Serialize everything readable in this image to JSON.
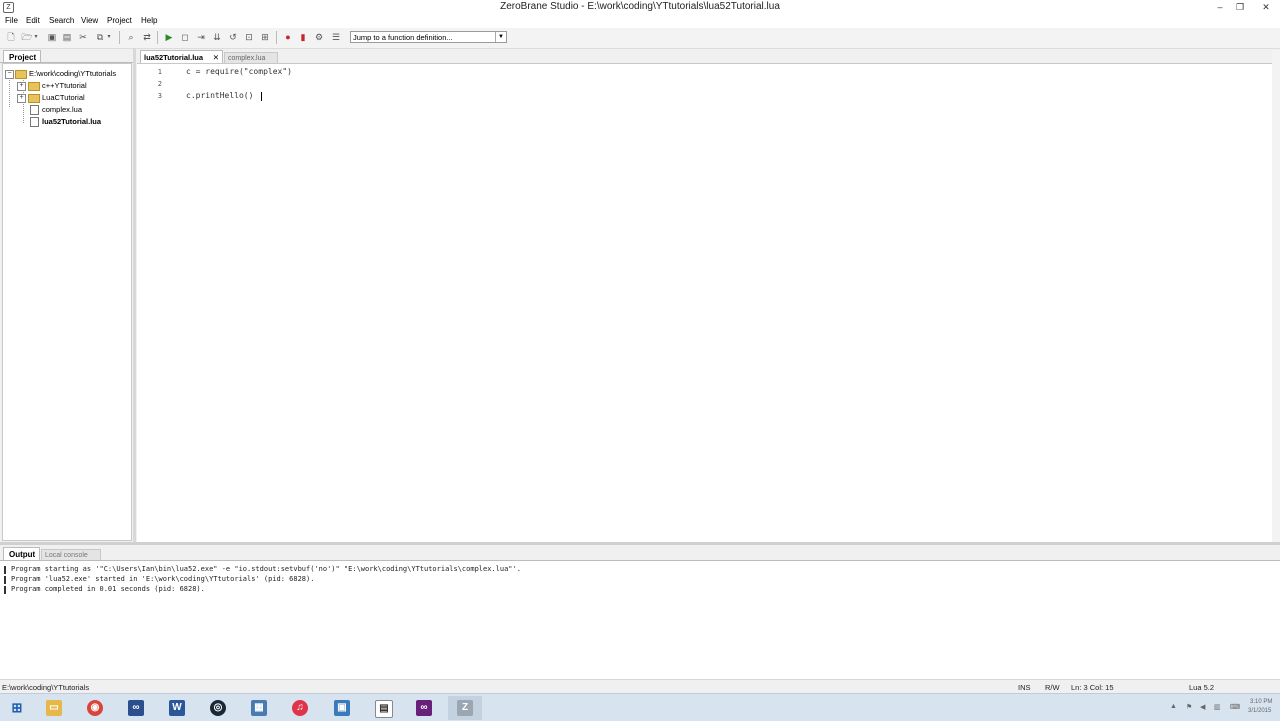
{
  "window": {
    "title": "ZeroBrane Studio - E:\\work\\coding\\YTtutorials\\lua52Tutorial.lua",
    "minimize": "–",
    "maximize": "❐",
    "close": "✕"
  },
  "menu": [
    "File",
    "Edit",
    "Search",
    "View",
    "Project",
    "Help"
  ],
  "toolbar": {
    "func_jump": "Jump to a function definition..."
  },
  "project": {
    "tab": "Project",
    "root": "E:\\work\\coding\\YTtutorials",
    "items": [
      {
        "label": "c++YTtutorial",
        "type": "folder"
      },
      {
        "label": "LuaCTutorial",
        "type": "folder"
      },
      {
        "label": "complex.lua",
        "type": "file"
      },
      {
        "label": "lua52Tutorial.lua",
        "type": "file",
        "active": true
      }
    ]
  },
  "editor": {
    "tabs": [
      {
        "label": "lua52Tutorial.lua",
        "close": "✕",
        "active": true
      },
      {
        "label": "complex.lua",
        "active": false
      }
    ],
    "lines": [
      {
        "no": "1",
        "text": "c = require(\"complex\")"
      },
      {
        "no": "2",
        "text": ""
      },
      {
        "no": "3",
        "text": "c.printHello()"
      }
    ]
  },
  "output": {
    "tabs": [
      {
        "label": "Output",
        "active": true
      },
      {
        "label": "Local console",
        "active": false
      }
    ],
    "lines": [
      "Program starting as '\"C:\\Users\\Ian\\bin\\lua52.exe\" -e \"io.stdout:setvbuf('no')\" \"E:\\work\\coding\\YTtutorials\\complex.lua\"'.",
      "Program 'lua52.exe' started in 'E:\\work\\coding\\YTtutorials' (pid: 6828).",
      "Program completed in 0.01 seconds (pid: 6828)."
    ]
  },
  "status": {
    "path": "E:\\work\\coding\\YTtutorials",
    "mode": "INS",
    "rw": "R/W",
    "position": "Ln: 3 Col: 15",
    "interpreter": "Lua 5.2"
  },
  "taskbar": {
    "apps": [
      "start-icon",
      "file-explorer-icon",
      "chrome-icon",
      "visual-studio-icon",
      "word-icon",
      "steam-icon",
      "calculator-icon",
      "itunes-icon",
      "app-icon",
      "notepad-icon",
      "visual-studio-2-icon",
      "zerobrane-icon"
    ],
    "clock": "3:10 PM",
    "date": "3/1/2015"
  }
}
